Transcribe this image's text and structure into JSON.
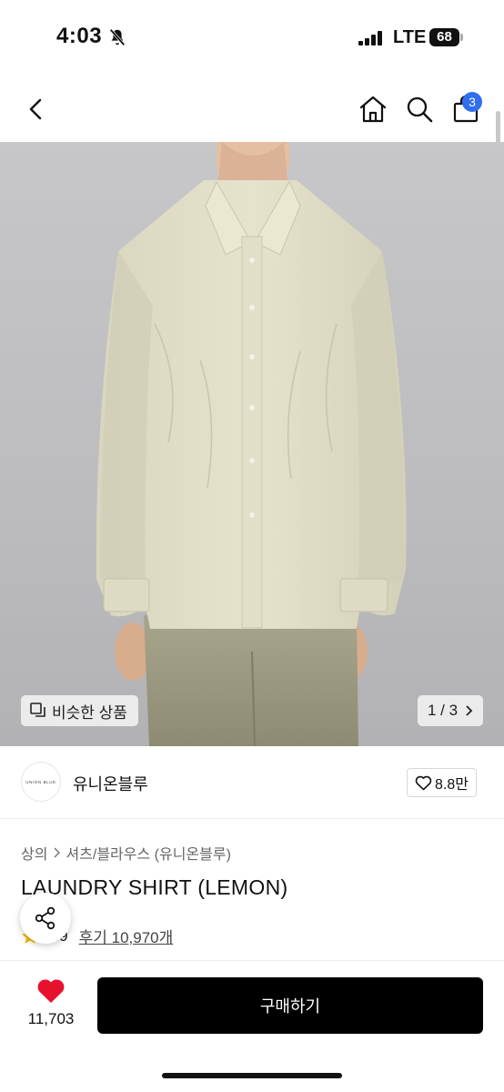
{
  "status_bar": {
    "time": "4:03",
    "network": "LTE",
    "battery": "68"
  },
  "nav": {
    "cart_count": "3",
    "icons": [
      "back-icon",
      "home-icon",
      "search-icon",
      "bag-icon"
    ]
  },
  "image": {
    "similar_label": "비슷한 상품",
    "page_current": "1",
    "page_total": "3",
    "page_sep": " / "
  },
  "brand": {
    "logo_text": "UNION BLUE",
    "name": "유니온블루",
    "likes": "8.8만"
  },
  "product": {
    "breadcrumb": [
      "상의",
      "셔츠/블라우스 (유니온블루)"
    ],
    "title": "LAUNDRY SHIRT (LEMON)",
    "rating": "4.9",
    "reviews": "후기 10,970개"
  },
  "bottom": {
    "wish_count": "11,703",
    "buy_label": "구매하기"
  },
  "colors": {
    "accent_badge": "#2f6fed",
    "heart": "#e8112d",
    "star": "#f5b800",
    "buy_button": "#000000"
  }
}
